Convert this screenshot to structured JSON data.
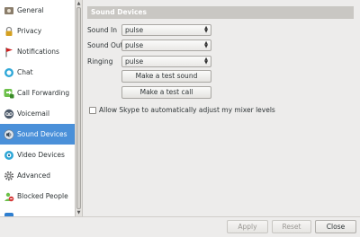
{
  "sidebar": {
    "items": [
      {
        "label": "General",
        "icon": "general-icon"
      },
      {
        "label": "Privacy",
        "icon": "lock-icon"
      },
      {
        "label": "Notifications",
        "icon": "flag-icon"
      },
      {
        "label": "Chat",
        "icon": "chat-bubble-icon"
      },
      {
        "label": "Call Forwarding",
        "icon": "phone-forward-icon"
      },
      {
        "label": "Voicemail",
        "icon": "voicemail-icon"
      },
      {
        "label": "Sound Devices",
        "icon": "speaker-icon",
        "selected": true
      },
      {
        "label": "Video Devices",
        "icon": "webcam-icon"
      },
      {
        "label": "Advanced",
        "icon": "gear-icon"
      },
      {
        "label": "Blocked People",
        "icon": "blocked-icon"
      }
    ]
  },
  "section": {
    "title": "Sound Devices"
  },
  "settings": {
    "sound_in": {
      "label": "Sound In",
      "value": "pulse"
    },
    "sound_out": {
      "label": "Sound Out",
      "value": "pulse"
    },
    "ringing": {
      "label": "Ringing",
      "value": "pulse"
    },
    "test_sound_label": "Make a test sound",
    "test_call_label": "Make a test call",
    "auto_adjust_label": "Allow Skype to automatically adjust my mixer levels",
    "auto_adjust_checked": false
  },
  "footer": {
    "apply_label": "Apply",
    "reset_label": "Reset",
    "close_label": "Close"
  },
  "colors": {
    "selection": "#4a90d9",
    "header_bg": "#c9c7c3"
  }
}
